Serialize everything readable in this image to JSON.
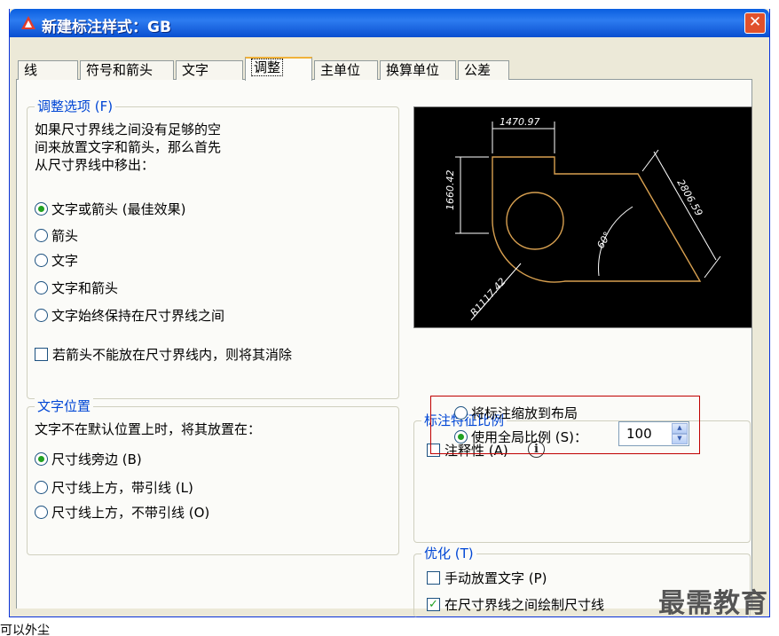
{
  "window": {
    "title": "新建标注样式：GB",
    "close_glyph": "✕"
  },
  "tabs": [
    {
      "label": "线"
    },
    {
      "label": "符号和箭头"
    },
    {
      "label": "文字"
    },
    {
      "label": "调整",
      "active": true
    },
    {
      "label": "主单位"
    },
    {
      "label": "换算单位"
    },
    {
      "label": "公差"
    }
  ],
  "fit_options": {
    "legend": "调整选项 (F)",
    "description": [
      "如果尺寸界线之间没有足够的空",
      "间来放置文字和箭头，那么首先",
      "从尺寸界线中移出："
    ],
    "radios": [
      {
        "label": "文字或箭头 (最佳效果)",
        "selected": true
      },
      {
        "label": "箭头",
        "selected": false
      },
      {
        "label": "文字",
        "selected": false
      },
      {
        "label": "文字和箭头",
        "selected": false
      },
      {
        "label": "文字始终保持在尺寸界线之间",
        "selected": false
      }
    ],
    "suppress_checkbox": {
      "label": "若箭头不能放在尺寸界线内，则将其消除",
      "checked": false
    }
  },
  "preview": {
    "dim_top": "1470.97",
    "dim_left": "1660.42",
    "dim_right": "2806.59",
    "dim_angle": "60°",
    "dim_radius": "R1117.42"
  },
  "text_placement": {
    "legend": "文字位置",
    "description": "文字不在默认位置上时，将其放置在：",
    "radios": [
      {
        "label": "尺寸线旁边 (B)",
        "selected": true
      },
      {
        "label": "尺寸线上方，带引线 (L)",
        "selected": false
      },
      {
        "label": "尺寸线上方，不带引线 (O)",
        "selected": false
      }
    ]
  },
  "scale": {
    "legend": "标注特征比例",
    "annotative": {
      "label": "注释性 (A)",
      "checked": false
    },
    "info_glyph": "i",
    "radios": [
      {
        "label": "将标注缩放到布局",
        "selected": false
      },
      {
        "label": "使用全局比例 (S)：",
        "selected": true
      }
    ],
    "global_scale_value": "100"
  },
  "finetune": {
    "legend": "优化 (T)",
    "manual": {
      "label": "手动放置文字 (P)",
      "checked": false
    },
    "draw_dim": {
      "label": "在尺寸界线之间绘制尺寸线",
      "checked": true
    }
  },
  "watermark": "最需教育",
  "caption": "可以外尘"
}
